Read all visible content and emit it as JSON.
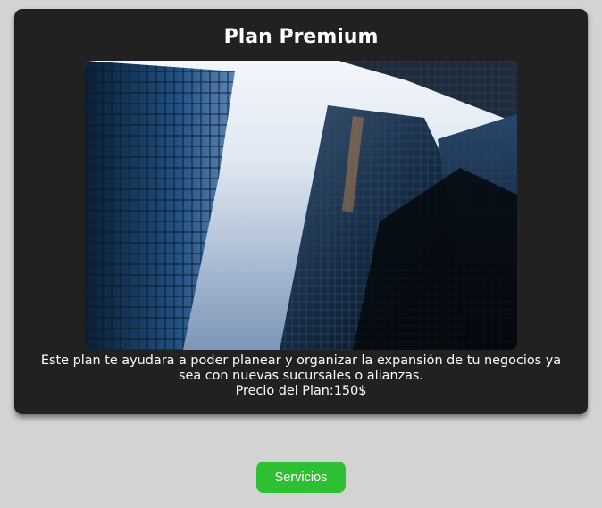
{
  "card": {
    "title": "Plan Premium",
    "description_line1": "Este plan te ayudara a poder planear y organizar la expansión de tu negocios ya sea con nuevas sucursales o alianzas.",
    "price_label": "Precio del Plan:",
    "price_value": "150$",
    "image": {
      "subject": "low-angle view of glass skyscrapers against a pale sky"
    }
  },
  "actions": {
    "servicios_label": "Servicios"
  },
  "colors": {
    "page_background": "#d3d3d3",
    "card_background": "#212121",
    "button_background": "#2fbf33",
    "text": "#ffffff"
  }
}
